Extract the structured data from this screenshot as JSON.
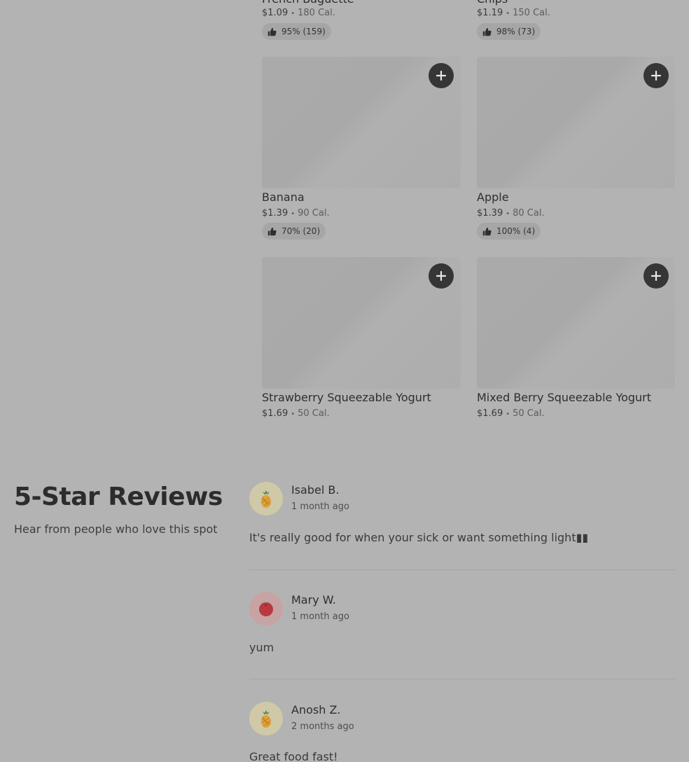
{
  "products": {
    "row0": [
      {
        "name": "French Baguette",
        "price": "$1.09",
        "calories": "180 Cal.",
        "rating": "95% (159)"
      },
      {
        "name": "Chips",
        "price": "$1.19",
        "calories": "150 Cal.",
        "rating": "98% (73)"
      }
    ],
    "row1": [
      {
        "name": "Banana",
        "price": "$1.39",
        "calories": "90 Cal.",
        "rating": "70% (20)"
      },
      {
        "name": "Apple",
        "price": "$1.39",
        "calories": "80 Cal.",
        "rating": "100% (4)"
      }
    ],
    "row2": [
      {
        "name": "Strawberry Squeezable Yogurt",
        "price": "$1.69",
        "calories": "50 Cal."
      },
      {
        "name": "Mixed Berry Squeezable Yogurt",
        "price": "$1.69",
        "calories": "50 Cal."
      }
    ],
    "separator": "•",
    "add_icon": "plus-icon",
    "rating_icon": "thumbs-up-icon"
  },
  "reviews": {
    "heading": "5-Star Reviews",
    "subheading": "Hear from people who love this spot",
    "items": [
      {
        "name": "Isabel B.",
        "time": "1 month ago",
        "text": "It's really good for when your sick or want something light▮▮",
        "avatar_icon": "pineapple-icon",
        "avatar_bg": "#cfc9a8"
      },
      {
        "name": "Mary W.",
        "time": "1 month ago",
        "text": "yum",
        "avatar_icon": "tomato-icon",
        "avatar_bg": "#c7a3a3"
      },
      {
        "name": "Anosh Z.",
        "time": "2 months ago",
        "text": "Great food fast!",
        "avatar_icon": "pineapple-icon",
        "avatar_bg": "#cfc9a8"
      }
    ]
  },
  "colors": {
    "background": "#b3b3b3",
    "add_button": "#363636",
    "rating_pill": "#a6a6a6"
  }
}
